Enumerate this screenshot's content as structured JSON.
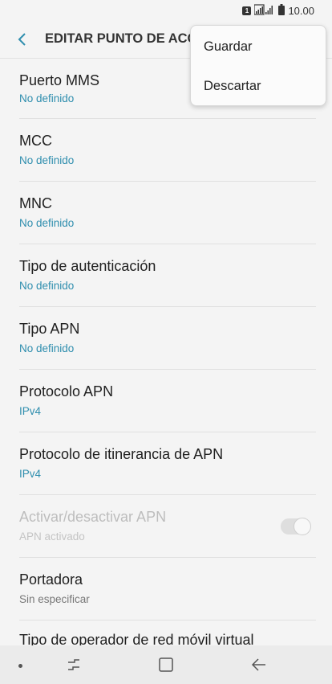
{
  "status_bar": {
    "sim": "1",
    "time": "10.00"
  },
  "app_bar": {
    "title": "EDITAR PUNTO DE ACCE"
  },
  "menu": {
    "items": [
      "Guardar",
      "Descartar"
    ]
  },
  "settings": [
    {
      "title": "Puerto MMS",
      "value": "No definido"
    },
    {
      "title": "MCC",
      "value": "No definido"
    },
    {
      "title": "MNC",
      "value": "No definido"
    },
    {
      "title": "Tipo de autenticación",
      "value": "No definido"
    },
    {
      "title": "Tipo APN",
      "value": "No definido"
    },
    {
      "title": "Protocolo APN",
      "value": "IPv4"
    },
    {
      "title": "Protocolo de itinerancia de APN",
      "value": "IPv4"
    },
    {
      "title": "Activar/desactivar APN",
      "value": "APN activado",
      "toggle_on": true,
      "enabled": false
    },
    {
      "title": "Portadora",
      "value": "Sin especificar"
    },
    {
      "title": "Tipo de operador de red móvil virtual"
    }
  ],
  "colors": {
    "accent": "#2f8eae",
    "background": "#f4f4f4"
  }
}
